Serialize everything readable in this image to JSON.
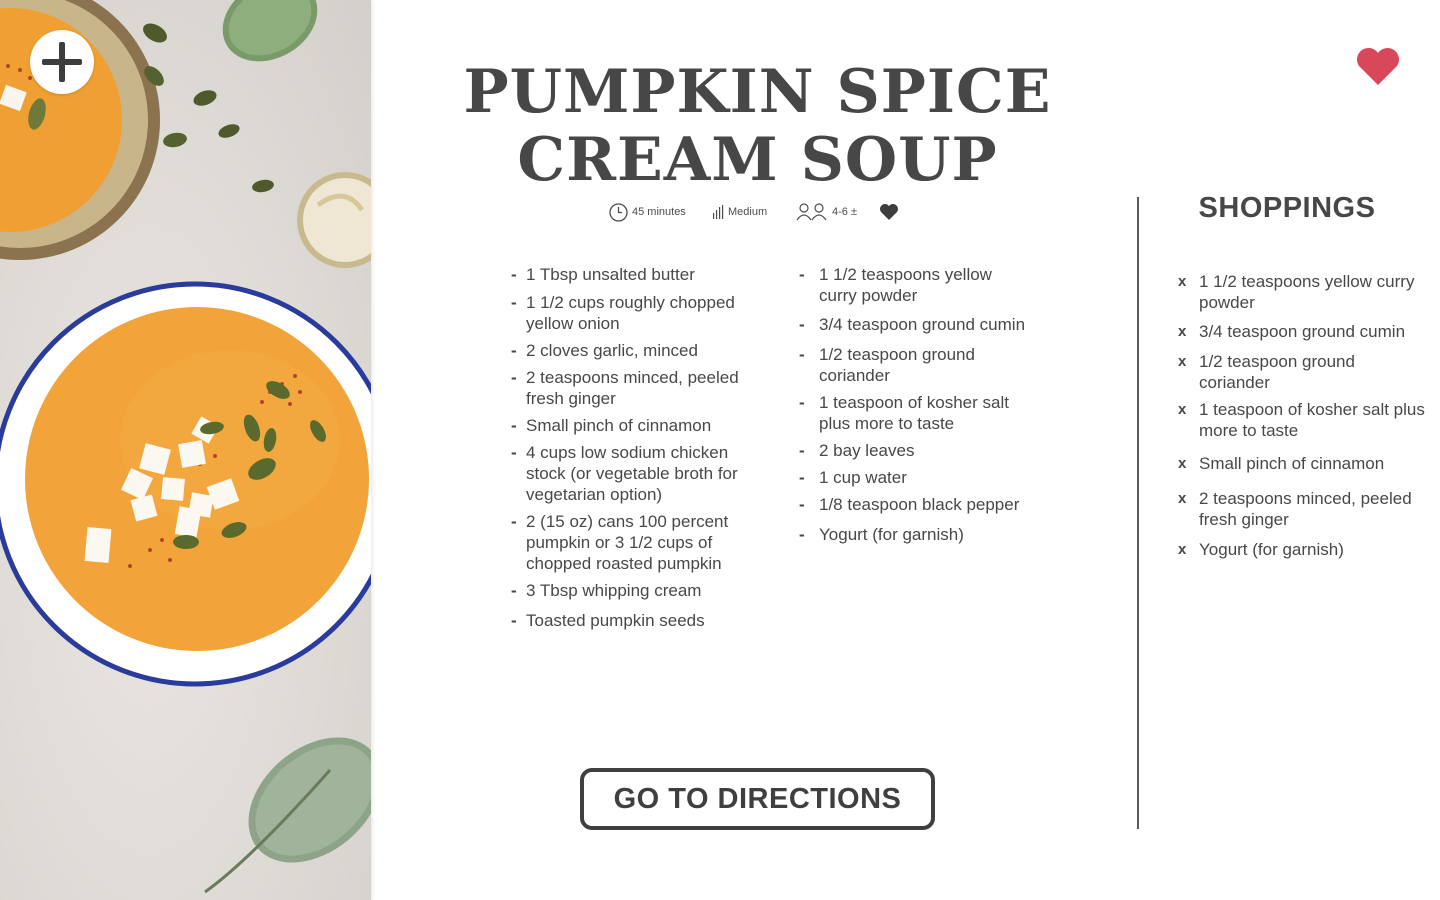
{
  "recipe": {
    "title_line1": "PUMPKIN SPICE",
    "title_line2": "CREAM SOUP",
    "time": "45 minutes",
    "difficulty": "Medium",
    "servings": "4-6 ±"
  },
  "ingredients": {
    "column1": [
      "1 Tbsp unsalted butter",
      "1 1/2 cups roughly chopped yellow onion",
      "2 cloves garlic, minced",
      "2 teaspoons minced, peeled fresh ginger",
      "Small pinch of cinnamon",
      "4 cups low sodium chicken stock (or vegetable broth for vegetarian option)",
      "2 (15 oz) cans 100 percent pumpkin or 3 1/2 cups of chopped roasted pumpkin",
      "3 Tbsp whipping cream",
      "Toasted pumpkin seeds"
    ],
    "column2": [
      "1 1/2 teaspoons yellow curry powder",
      "3/4 teaspoon ground cumin",
      "1/2 teaspoon ground coriander",
      "1 teaspoon of kosher salt plus more to taste",
      "2 bay leaves",
      "1 cup water",
      "1/8 teaspoon black pepper",
      "Yogurt (for garnish)"
    ]
  },
  "shopping": {
    "title": "SHOPPINGS",
    "remove_symbol": "x",
    "items": [
      "1 1/2 teaspoons yellow curry powder",
      "3/4 teaspoon ground cumin",
      "1/2 teaspoon ground coriander",
      "1 teaspoon of kosher salt plus more to taste",
      "Small pinch of cinnamon",
      "2 teaspoons minced, peeled fresh ginger",
      "Yogurt (for garnish)"
    ]
  },
  "dash_symbol": "-",
  "directions_button": "GO TO DIRECTIONS",
  "icons": {
    "add": "plus-icon",
    "time": "clock-icon",
    "difficulty": "bars-icon",
    "servings": "people-icon",
    "like": "heart-icon",
    "favorite": "heart-icon"
  },
  "colors": {
    "text": "#474747",
    "favorite_heart": "#d9475b",
    "soup": "#f2a33a",
    "bowl_rim": "#2a3b9c"
  }
}
